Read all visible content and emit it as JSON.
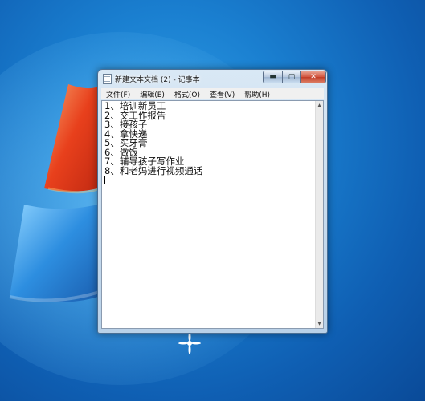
{
  "window": {
    "title": "新建文本文档 (2) - 记事本",
    "controls": {
      "minimize": "▬",
      "maximize": "▢",
      "close": "✕"
    }
  },
  "menu": {
    "items": [
      {
        "label": "文件(F)"
      },
      {
        "label": "编辑(E)"
      },
      {
        "label": "格式(O)"
      },
      {
        "label": "查看(V)"
      },
      {
        "label": "帮助(H)"
      }
    ]
  },
  "editor": {
    "lines": [
      "1、培训新员工",
      "2、交工作报告",
      "3、接孩子",
      "4、拿快递",
      "5、买牙膏",
      "6、做饭",
      "7、辅导孩子写作业",
      "8、和老妈进行视频通话"
    ]
  },
  "scrollbar": {
    "up_arrow": "▲",
    "down_arrow": "▼"
  },
  "colors": {
    "desktop": "#1a7fd0",
    "logo_red": "#e8401c",
    "logo_orange": "#f5a11a",
    "logo_blue": "#2d8ee0",
    "close_button": "#c9422b"
  }
}
